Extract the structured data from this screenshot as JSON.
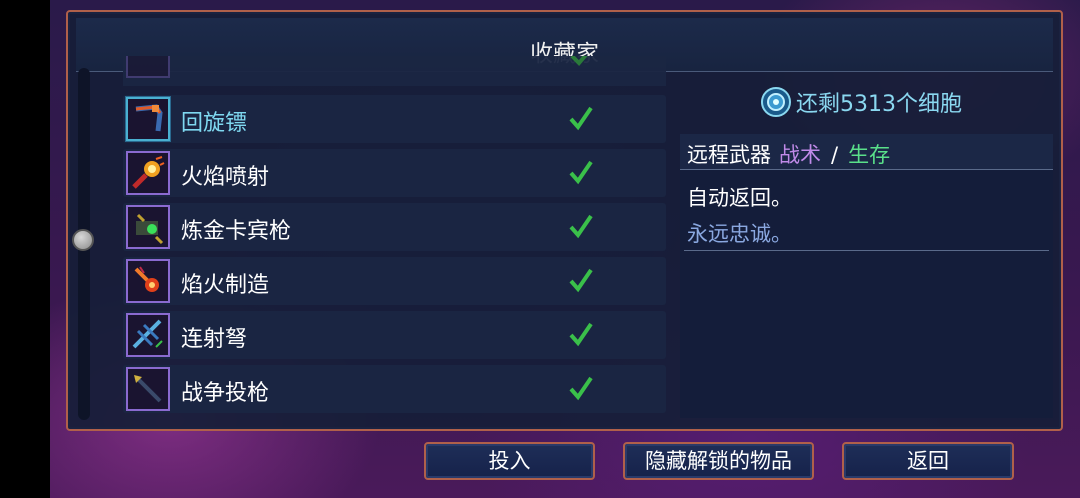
{
  "panel": {
    "title": "收藏家"
  },
  "currency": {
    "text": "还剩5313个细胞",
    "icon": "cell-icon",
    "color": "#8ad8f0"
  },
  "items": [
    {
      "name": "回旋镖",
      "unlocked": true,
      "selected": true,
      "icon": "boomerang-icon"
    },
    {
      "name": "火焰喷射",
      "unlocked": true,
      "selected": false,
      "icon": "flamethrower-icon"
    },
    {
      "name": "炼金卡宾枪",
      "unlocked": true,
      "selected": false,
      "icon": "alchemic-carbine-icon"
    },
    {
      "name": "焰火制造",
      "unlocked": true,
      "selected": false,
      "icon": "fireworks-icon"
    },
    {
      "name": "连射弩",
      "unlocked": true,
      "selected": false,
      "icon": "repeater-crossbow-icon"
    },
    {
      "name": "战争投枪",
      "unlocked": true,
      "selected": false,
      "icon": "war-javelin-icon"
    }
  ],
  "description": {
    "category": "远程武器",
    "tag1": "战术",
    "separator": "/",
    "tag2": "生存",
    "line1": "自动返回。",
    "line2": "永远忠诚。"
  },
  "buttons": {
    "invest": "投入",
    "hide_unlocked": "隐藏解锁的物品",
    "back": "返回"
  },
  "colors": {
    "frame": "#b0604a",
    "selected_label": "#7fd8f0",
    "tactics": "#c08ae8",
    "survival": "#5ae08a",
    "check": "#3ac04a"
  }
}
